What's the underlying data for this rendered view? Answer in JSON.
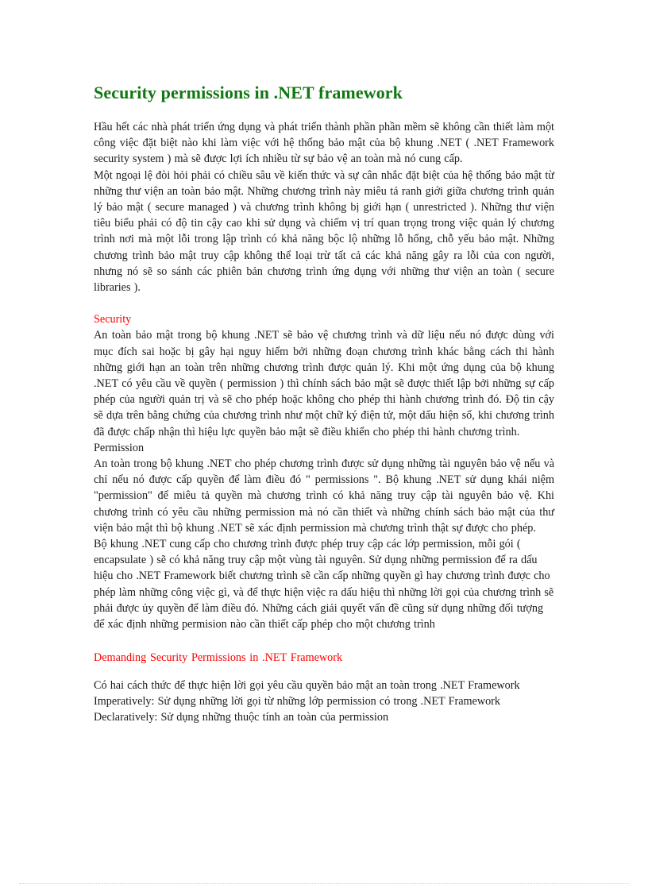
{
  "document": {
    "title": "Security permissions in .NET framework",
    "title_color": "#117711",
    "heading_color": "#ff0000",
    "body_color": "#1a1a1a",
    "intro": {
      "paragraph_1": "Hầu hết các nhà phát triển ứng dụng và phát triển thành phần phần mềm sẽ không cần thiết làm một công việc đặt biệt nào khi làm việc với hệ thống bảo mật của bộ khung .NET ( .NET Framework security  system ) mà sẽ được lợi ích nhiều từ sự bảo vệ an toàn mà nó cung cấp.",
      "paragraph_2": "Một ngoại lệ đòi hỏi phải có chiều  sâu về kiến  thức và sự cân nhắc  đặt biệt của hệ thống bảo mật từ những  thư viện  an toàn bảo mật. Những  chương  trình  này miêu  tả ranh  giới giữa chương  trình  quản lý bảo mật ( secure managed ) và chương  trình  không bị giới  hạn ( unrestricted  ). Những thư viện tiêu biểu phải có độ tin cậy cao khi sử dụng và chiếm vị trí quan trọng trong việc  quản lý chương  trình  nơi mà một lỗi trong lập trình  có khả năng bộc lộ những lỗ hổng, chỗ yếu bảo mật. Những chương trình  bảo mật truy cập không thể loại trừ tất cả các khả năng gây ra lỗi của con người, nhưng nó sẽ so sánh các phiên  bản chương trình ứng dụng với những  thư viện  an toàn ( secure libraries  )."
    },
    "security_section": {
      "heading": "Security",
      "paragraph_1": "An toàn bảo mật trong  bộ khung  .NET sẽ bảo vệ chương trình  và dữ liệu  nếu nó được dùng với mục đích sai hoặc bị gây hại nguy  hiểm  bởi những  đoạn chương trình khác bằng cách thi hành những  giới  hạn an toàn trên những  chương  trình  được quản lý. Khi một ứng dụng của bộ khung  .NET có yêu  cầu về quyền ( permission  ) thì chính  sách bảo mật sẽ được thiết  lập bởi những  sự cấp phép của người  quản trị và sẽ cho phép hoặc không cho phép thi hành  chương  trình  đó. Độ tin  cậy sẽ dựa trên bằng chứng của chương  trình  như một chữ ký điện tử, một dấu hiện  số, khi  chương  trình  đã được chấp nhận thì hiệu lực quyền bảo mật sẽ điều khiển  cho phép thi hành chương  trình."
    },
    "permission_section": {
      "heading": "Permission",
      "paragraph_1": "An toàn trong  bộ khung  .NET cho phép chương trình  được sử dụng những tài nguyên  bảo vệ nếu và chỉ nếu nó được cấp quyền để làm điều đó \" permissions  \". Bộ khung  .NET sử dụng khái niệm \"permission\"  để miêu tả quyền mà chương trình  có khả năng truy  cập tài nguyên  bảo vệ. Khi chương  trình  có yêu cầu những  permission  mà nó cần thiết và những chính  sách bảo mật của thư viện  bảo mật thì bộ khung  .NET sẽ xác định  permission  mà chương trình  thật sự được cho phép.",
      "paragraph_2": "Bộ khung  .NET cung  cấp cho chương trình  được phép truy  cập các lớp permission,  mỗi gói ( encapsulate  ) sẽ có khả năng truy  cập một vùng tài nguyên.  Sử dụng những permission  để ra dấu hiệu cho .NET Framework biết chương  trình  sẽ cần cấp những quyền gì hay chương trình  được cho phép làm những công việc  gì, và để thực hiện việc  ra dấu hiệu  thì những lời  gọi của chương  trình  sẽ phải  được ủy  quyền để làm điều  đó. Những cách giải  quyết vấn đề cũng sử dụng những  đối tượng để xác định  những permision  nào cần thiết  cấp phép cho một chương  trình"
    },
    "demanding_section": {
      "heading": "Demanding  Security  Permissions  in .NET Framework",
      "paragraph_1": "Có hai cách thức để thực hiện  lời  gọi yêu  cầu quyền  bảo mật an toàn trong .NET Framework",
      "item_imperative": "Imperatively:   Sử dụng những lời  gọi từ những  lớp permission  có trong  .NET Framework",
      "item_declarative": "Declaratively:   Sử dụng những  thuộc tính  an toàn của permission"
    },
    "page_break_marker": {
      "style": "dotted",
      "color": "#ff99cc"
    }
  }
}
